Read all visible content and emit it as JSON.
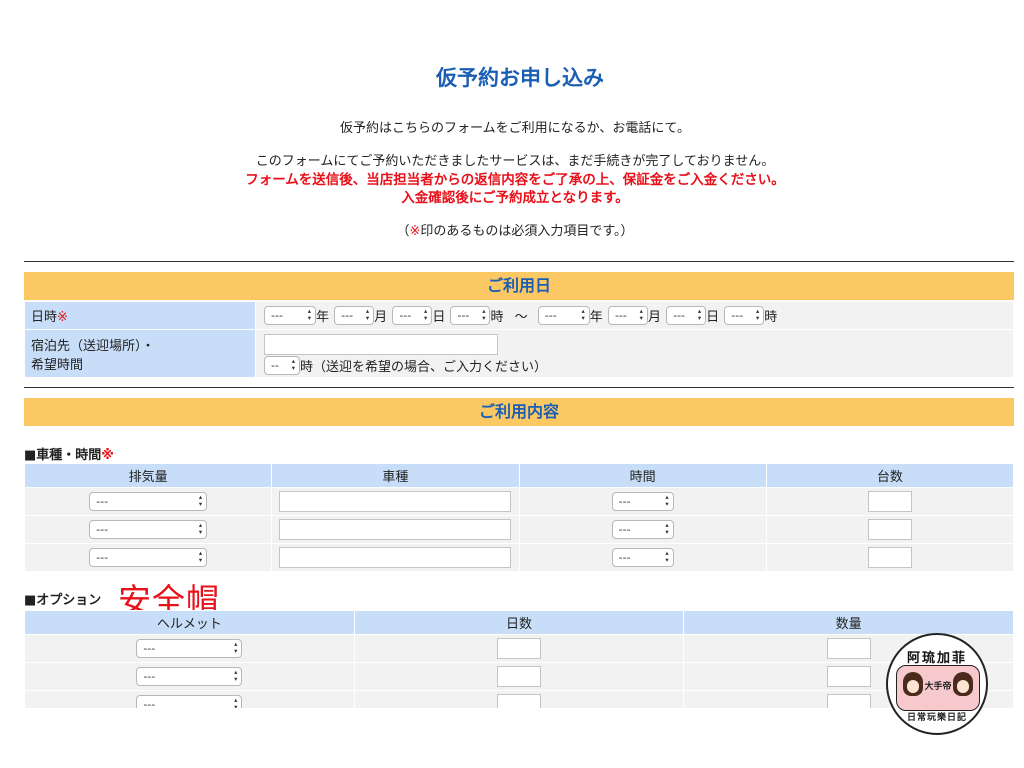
{
  "page": {
    "title": "仮予約お申し込み",
    "intro1": "仮予約はこちらのフォームをご利用になるか、お電話にて。",
    "intro2": "このフォームにてご予約いただきましたサービスは、まだ手続きが完了しておりません。",
    "intro3": "フォームを送信後、当店担当者からの返信内容をご了承の上、保証金をご入金ください。",
    "intro4": "入金確認後にご予約成立となります。",
    "note_prefix": "（",
    "note_mark": "※",
    "note_suffix": "印のあるものは必須入力項目です。）"
  },
  "usage_date": {
    "section_title": "ご利用日",
    "datetime_label": "日時",
    "required_mark": "※",
    "select_placeholder": "---",
    "year": "年",
    "month": "月",
    "day": "日",
    "hour": "時",
    "tilde": "〜",
    "lodging_label_line1": "宿泊先（送迎場所）・",
    "lodging_label_line2": "希望時間",
    "lodging_hour_value": "--",
    "lodging_hour_unit": "時（送迎を希望の場合、ご入力ください）"
  },
  "usage_content": {
    "section_title": "ご利用内容",
    "vehicle_heading": "■車種・時間",
    "required_mark": "※",
    "vehicle_columns": [
      "排気量",
      "車種",
      "時間",
      "台数"
    ],
    "vehicle_rows": [
      {
        "displacement": "---",
        "time": "---"
      },
      {
        "displacement": "---",
        "time": "---"
      },
      {
        "displacement": "---",
        "time": "---"
      }
    ],
    "option_heading": "■オプション",
    "option_annotation": "安全帽",
    "option_columns": [
      "ヘルメット",
      "日数",
      "数量"
    ],
    "option_rows": [
      {
        "helmet": "---"
      },
      {
        "helmet": "---"
      },
      {
        "helmet": "---"
      }
    ]
  },
  "watermark": {
    "top": "阿琉加菲",
    "middle": "大手帝",
    "bottom": "日常玩樂日記"
  },
  "colors": {
    "title_blue": "#1a5fb4",
    "alert_red": "#e8101a",
    "section_orange": "#fcc864",
    "label_blue": "#c8ddf7",
    "field_gray": "#f2f2f2"
  }
}
